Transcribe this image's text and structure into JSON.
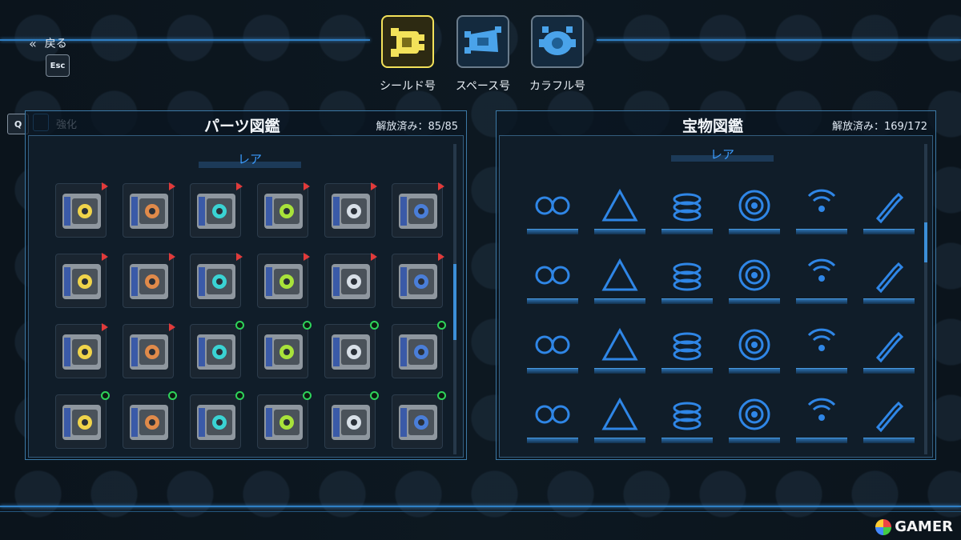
{
  "nav": {
    "back_label": "戻る",
    "esc_key": "Esc"
  },
  "ships": [
    {
      "label": "シールド号",
      "selected": true,
      "color": "#f3e25a"
    },
    {
      "label": "スペース号",
      "selected": false,
      "color": "#4aa3ea"
    },
    {
      "label": "カラフル号",
      "selected": false,
      "color": "#4aa3ea"
    }
  ],
  "parts_panel": {
    "q_key": "Q",
    "enhance_label": "強化",
    "title": "パーツ図鑑",
    "unlocked": "解放済み：85/85",
    "rarity": "レア",
    "items": [
      {
        "icon": "explosion-part-icon",
        "mark": "red"
      },
      {
        "icon": "moon-part-icon",
        "mark": "red"
      },
      {
        "icon": "hexagram-part-icon",
        "mark": "red"
      },
      {
        "icon": "play-ring-part-icon",
        "mark": "red"
      },
      {
        "icon": "yellow-arrows-part-icon",
        "mark": "red"
      },
      {
        "icon": "ring-part-icon",
        "mark": "red"
      },
      {
        "icon": "hexagon-mesh-part-icon",
        "mark": "red"
      },
      {
        "icon": "coil-part-icon",
        "mark": "red"
      },
      {
        "icon": "gear-frame-part-icon",
        "mark": "red"
      },
      {
        "icon": "twin-core-part-icon",
        "mark": "red"
      },
      {
        "icon": "green-laser-part-icon",
        "mark": "red"
      },
      {
        "icon": "claw-part-icon",
        "mark": "red"
      },
      {
        "icon": "shield-block-part-icon",
        "mark": "red"
      },
      {
        "icon": "lightning-block-part-icon",
        "mark": "red"
      },
      {
        "icon": "up-arrow-part-icon",
        "mark": "green"
      },
      {
        "icon": "tank-part-icon",
        "mark": "green"
      },
      {
        "icon": "emitter-part-icon",
        "mark": "green"
      },
      {
        "icon": "cog-part-icon",
        "mark": "green"
      },
      {
        "icon": "spark-cell-part-icon",
        "mark": "green"
      },
      {
        "icon": "chevron-shield-part-icon",
        "mark": "green"
      },
      {
        "icon": "cross-joint-part-icon",
        "mark": "green"
      },
      {
        "icon": "disc-part-icon",
        "mark": "green"
      },
      {
        "icon": "liquid-tank-part-icon",
        "mark": "green"
      },
      {
        "icon": "crack-plate-part-icon",
        "mark": "green"
      }
    ]
  },
  "treasure_panel": {
    "title": "宝物図鑑",
    "unlocked": "解放済み：169/172",
    "rarity": "レア",
    "items": [
      {
        "icon": "twin-faces-icon"
      },
      {
        "icon": "pyramid-icon"
      },
      {
        "icon": "coin-stack-icon"
      },
      {
        "icon": "target-rings-icon"
      },
      {
        "icon": "signal-icon"
      },
      {
        "icon": "champagne-icon"
      },
      {
        "icon": "spray-gun-icon"
      },
      {
        "icon": "shield-bolt-icon"
      },
      {
        "icon": "drone-icon"
      },
      {
        "icon": "dart-target-icon"
      },
      {
        "icon": "fidget-spinner-icon"
      },
      {
        "icon": "flashlight-icon"
      },
      {
        "icon": "ring-dish-icon"
      },
      {
        "icon": "flame-icon"
      },
      {
        "icon": "radioactive-barrel-icon"
      },
      {
        "icon": "jar-icon"
      },
      {
        "icon": "bottle-opener-icon"
      },
      {
        "icon": "robot-icon"
      },
      {
        "icon": "devil-face-icon"
      },
      {
        "icon": "heartbeat-icon"
      },
      {
        "icon": "monitor-chevron-icon"
      },
      {
        "icon": "award-badge-icon"
      },
      {
        "icon": "code-window-icon"
      },
      {
        "icon": "crosshair-disc-icon"
      }
    ]
  },
  "watermark": "GAMER",
  "colors": {
    "accent": "#3c8fd8",
    "treasure_icon": "#2f86e6",
    "selected_ship": "#f3e25a"
  }
}
